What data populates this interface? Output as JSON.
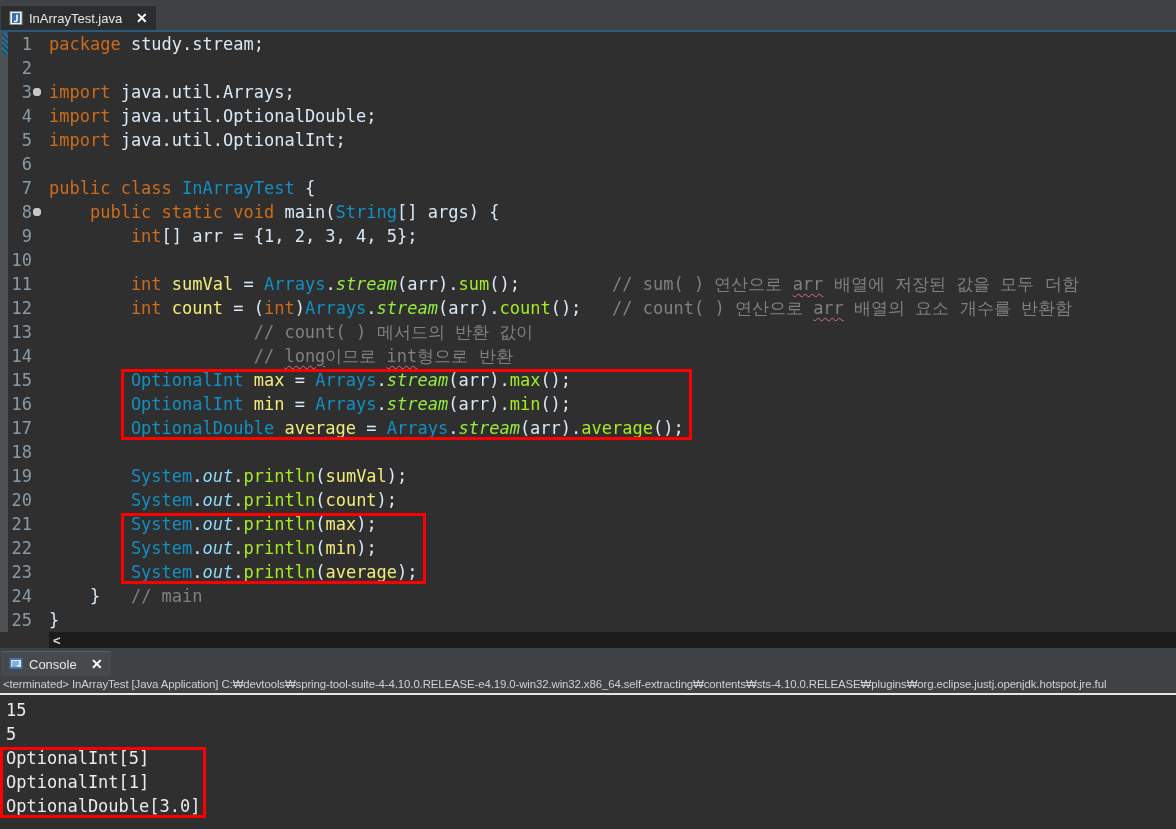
{
  "editor": {
    "tab": {
      "label": "InArrayTest.java",
      "close": "✕",
      "selected": true
    },
    "lines": [
      {
        "number": "1",
        "marker": true,
        "tokens": [
          {
            "kind": "kw",
            "text": "package"
          },
          {
            "kind": "plain",
            "text": " study.stream;"
          }
        ]
      },
      {
        "number": "2"
      },
      {
        "number": "3",
        "fold": true,
        "tokens": [
          {
            "kind": "kw",
            "text": "import"
          },
          {
            "kind": "plain",
            "text": " java.util.Arrays;"
          }
        ]
      },
      {
        "number": "4",
        "tokens": [
          {
            "kind": "kw",
            "text": "import"
          },
          {
            "kind": "plain",
            "text": " java.util.OptionalDouble;"
          }
        ]
      },
      {
        "number": "5",
        "tokens": [
          {
            "kind": "kw",
            "text": "import"
          },
          {
            "kind": "plain",
            "text": " java.util.OptionalInt;"
          }
        ]
      },
      {
        "number": "6"
      },
      {
        "number": "7",
        "tokens": [
          {
            "kind": "kw",
            "text": "public class"
          },
          {
            "kind": "type",
            "text": " InArrayTest"
          },
          {
            "kind": "plain",
            "text": " {"
          }
        ]
      },
      {
        "number": "8",
        "fold": true,
        "tokens": [
          {
            "kind": "kw",
            "text": "    public static void"
          },
          {
            "kind": "plain",
            "text": " main("
          },
          {
            "kind": "type",
            "text": "String"
          },
          {
            "kind": "plain",
            "text": "[] args) {"
          }
        ]
      },
      {
        "number": "9",
        "tokens": [
          {
            "kind": "kw",
            "text": "        int"
          },
          {
            "kind": "plain",
            "text": "[] arr = {1, 2, 3, 4, 5};"
          }
        ]
      },
      {
        "number": "10"
      },
      {
        "number": "11",
        "tokens": [
          {
            "kind": "kw",
            "text": "        int"
          },
          {
            "kind": "local",
            "text": " sumVal"
          },
          {
            "kind": "plain",
            "text": " = "
          },
          {
            "kind": "type",
            "text": "Arrays"
          },
          {
            "kind": "plain",
            "text": "."
          },
          {
            "kind": "smethod",
            "text": "stream"
          },
          {
            "kind": "plain",
            "text": "(arr)."
          },
          {
            "kind": "method",
            "text": "sum"
          },
          {
            "kind": "plain",
            "text": "();"
          },
          {
            "kind": "comment",
            "text": "         // sum( ) 연산으로 "
          },
          {
            "kind": "comment",
            "text": "arr",
            "spell_error": true
          },
          {
            "kind": "comment",
            "text": " 배열에 저장된 값을 모두 더함"
          }
        ]
      },
      {
        "number": "12",
        "tokens": [
          {
            "kind": "kw",
            "text": "        int"
          },
          {
            "kind": "local",
            "text": " count"
          },
          {
            "kind": "plain",
            "text": " = ("
          },
          {
            "kind": "kw",
            "text": "int"
          },
          {
            "kind": "plain",
            "text": ")"
          },
          {
            "kind": "type",
            "text": "Arrays"
          },
          {
            "kind": "plain",
            "text": "."
          },
          {
            "kind": "smethod",
            "text": "stream"
          },
          {
            "kind": "plain",
            "text": "(arr)."
          },
          {
            "kind": "method",
            "text": "count"
          },
          {
            "kind": "plain",
            "text": "();"
          },
          {
            "kind": "comment",
            "text": "   // count( ) 연산으로 "
          },
          {
            "kind": "comment",
            "text": "arr",
            "spell_error": true
          },
          {
            "kind": "comment",
            "text": " 배열의 요소 개수를 반환함"
          }
        ]
      },
      {
        "number": "13",
        "tokens": [
          {
            "kind": "comment",
            "text": "                    // count( ) 메서드의 반환 값이"
          }
        ]
      },
      {
        "number": "14",
        "tokens": [
          {
            "kind": "comment",
            "text": "                    // "
          },
          {
            "kind": "comment",
            "text": "long",
            "spell_error": true
          },
          {
            "kind": "comment",
            "text": "이므로 "
          },
          {
            "kind": "comment",
            "text": "int",
            "spell_error": true
          },
          {
            "kind": "comment",
            "text": "형으로 반환"
          }
        ]
      },
      {
        "number": "15",
        "boxed": true,
        "tokens": [
          {
            "kind": "type",
            "text": "        OptionalInt"
          },
          {
            "kind": "local",
            "text": " max"
          },
          {
            "kind": "plain",
            "text": " = "
          },
          {
            "kind": "type",
            "text": "Arrays"
          },
          {
            "kind": "plain",
            "text": "."
          },
          {
            "kind": "smethod",
            "text": "stream"
          },
          {
            "kind": "plain",
            "text": "(arr)."
          },
          {
            "kind": "method",
            "text": "max"
          },
          {
            "kind": "plain",
            "text": "();"
          }
        ]
      },
      {
        "number": "16",
        "boxed": true,
        "tokens": [
          {
            "kind": "type",
            "text": "        OptionalInt"
          },
          {
            "kind": "local",
            "text": " min"
          },
          {
            "kind": "plain",
            "text": " = "
          },
          {
            "kind": "type",
            "text": "Arrays"
          },
          {
            "kind": "plain",
            "text": "."
          },
          {
            "kind": "smethod",
            "text": "stream"
          },
          {
            "kind": "plain",
            "text": "(arr)."
          },
          {
            "kind": "method",
            "text": "min"
          },
          {
            "kind": "plain",
            "text": "();"
          }
        ]
      },
      {
        "number": "17",
        "boxed": true,
        "tokens": [
          {
            "kind": "type",
            "text": "        OptionalDouble"
          },
          {
            "kind": "local",
            "text": " average"
          },
          {
            "kind": "plain",
            "text": " = "
          },
          {
            "kind": "type",
            "text": "Arrays"
          },
          {
            "kind": "plain",
            "text": "."
          },
          {
            "kind": "smethod",
            "text": "stream"
          },
          {
            "kind": "plain",
            "text": "(arr)."
          },
          {
            "kind": "method",
            "text": "average"
          },
          {
            "kind": "plain",
            "text": "();"
          }
        ]
      },
      {
        "number": "18"
      },
      {
        "number": "19",
        "tokens": [
          {
            "kind": "type",
            "text": "        System"
          },
          {
            "kind": "plain",
            "text": "."
          },
          {
            "kind": "sfield",
            "text": "out"
          },
          {
            "kind": "plain",
            "text": "."
          },
          {
            "kind": "method",
            "text": "println"
          },
          {
            "kind": "plain",
            "text": "("
          },
          {
            "kind": "local",
            "text": "sumVal"
          },
          {
            "kind": "plain",
            "text": ");"
          }
        ]
      },
      {
        "number": "20",
        "tokens": [
          {
            "kind": "type",
            "text": "        System"
          },
          {
            "kind": "plain",
            "text": "."
          },
          {
            "kind": "sfield",
            "text": "out"
          },
          {
            "kind": "plain",
            "text": "."
          },
          {
            "kind": "method",
            "text": "println"
          },
          {
            "kind": "plain",
            "text": "("
          },
          {
            "kind": "local",
            "text": "count"
          },
          {
            "kind": "plain",
            "text": ");"
          }
        ]
      },
      {
        "number": "21",
        "boxed": true,
        "tokens": [
          {
            "kind": "type",
            "text": "        System"
          },
          {
            "kind": "plain",
            "text": "."
          },
          {
            "kind": "sfield",
            "text": "out"
          },
          {
            "kind": "plain",
            "text": "."
          },
          {
            "kind": "method",
            "text": "println"
          },
          {
            "kind": "plain",
            "text": "("
          },
          {
            "kind": "local",
            "text": "max"
          },
          {
            "kind": "plain",
            "text": ");"
          }
        ]
      },
      {
        "number": "22",
        "boxed": true,
        "tokens": [
          {
            "kind": "type",
            "text": "        System"
          },
          {
            "kind": "plain",
            "text": "."
          },
          {
            "kind": "sfield",
            "text": "out"
          },
          {
            "kind": "plain",
            "text": "."
          },
          {
            "kind": "method",
            "text": "println"
          },
          {
            "kind": "plain",
            "text": "("
          },
          {
            "kind": "local",
            "text": "min"
          },
          {
            "kind": "plain",
            "text": ");"
          }
        ]
      },
      {
        "number": "23",
        "boxed": true,
        "tokens": [
          {
            "kind": "type",
            "text": "        System"
          },
          {
            "kind": "plain",
            "text": "."
          },
          {
            "kind": "sfield",
            "text": "out"
          },
          {
            "kind": "plain",
            "text": "."
          },
          {
            "kind": "method",
            "text": "println"
          },
          {
            "kind": "plain",
            "text": "("
          },
          {
            "kind": "local",
            "text": "average"
          },
          {
            "kind": "plain",
            "text": ");"
          }
        ]
      },
      {
        "number": "24",
        "tokens": [
          {
            "kind": "plain",
            "text": "    }"
          },
          {
            "kind": "comment",
            "text": "   // main"
          }
        ]
      },
      {
        "number": "25",
        "tokens": [
          {
            "kind": "plain",
            "text": "}"
          }
        ]
      }
    ],
    "scroll_left": "<"
  },
  "console": {
    "tab": {
      "label": "Console",
      "close": "✕",
      "selected": true
    },
    "status": "<terminated> InArrayTest [Java Application] C:₩devtools₩spring-tool-suite-4-4.10.0.RELEASE-e4.19.0-win32.win32.x86_64.self-extracting₩contents₩sts-4.10.0.RELEASE₩plugins₩org.eclipse.justj.openjdk.hotspot.jre.ful",
    "output": [
      {
        "text": "15"
      },
      {
        "text": "5"
      },
      {
        "text": "OptionalInt[5]",
        "boxed": true
      },
      {
        "text": "OptionalInt[1]",
        "boxed": true
      },
      {
        "text": "OptionalDouble[3.0]",
        "boxed": true
      }
    ]
  }
}
